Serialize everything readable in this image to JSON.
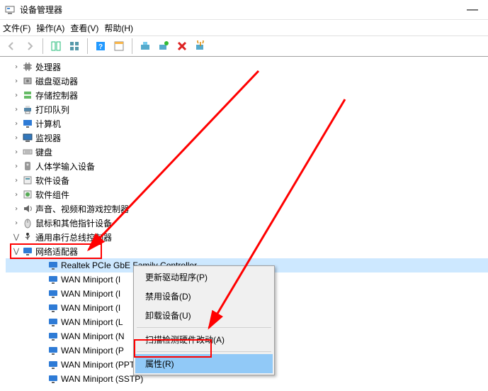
{
  "window": {
    "title": "设备管理器"
  },
  "menu": {
    "file": "文件(F)",
    "action": "操作(A)",
    "view": "查看(V)",
    "help": "帮助(H)"
  },
  "tree": {
    "items": [
      {
        "label": "处理器",
        "icon": "cpu"
      },
      {
        "label": "磁盘驱动器",
        "icon": "disk"
      },
      {
        "label": "存储控制器",
        "icon": "storage"
      },
      {
        "label": "打印队列",
        "icon": "printer"
      },
      {
        "label": "计算机",
        "icon": "computer"
      },
      {
        "label": "监视器",
        "icon": "monitor"
      },
      {
        "label": "键盘",
        "icon": "keyboard"
      },
      {
        "label": "人体学输入设备",
        "icon": "hid"
      },
      {
        "label": "软件设备",
        "icon": "swdev"
      },
      {
        "label": "软件组件",
        "icon": "swcomp"
      },
      {
        "label": "声音、视频和游戏控制器",
        "icon": "sound"
      },
      {
        "label": "鼠标和其他指针设备",
        "icon": "mouse"
      },
      {
        "label": "通用串行总线控制器",
        "icon": "usb",
        "expanded_icon": true
      }
    ],
    "network_adapter_label": "网络适配器",
    "network_children": [
      {
        "label": "Realtek PCIe GbE Family Controller",
        "selected": true
      },
      {
        "label": "WAN Miniport (I"
      },
      {
        "label": "WAN Miniport (I"
      },
      {
        "label": "WAN Miniport (I"
      },
      {
        "label": "WAN Miniport (L"
      },
      {
        "label": "WAN Miniport (N"
      },
      {
        "label": "WAN Miniport (P"
      },
      {
        "label": "WAN Miniport (PPTP)"
      },
      {
        "label": "WAN Miniport (SSTP)"
      }
    ]
  },
  "context_menu": {
    "items": [
      "更新驱动程序(P)",
      "禁用设备(D)",
      "卸载设备(U)",
      "---",
      "扫描检测硬件改动(A)",
      "---",
      "属性(R)"
    ],
    "highlighted": "属性(R)"
  }
}
